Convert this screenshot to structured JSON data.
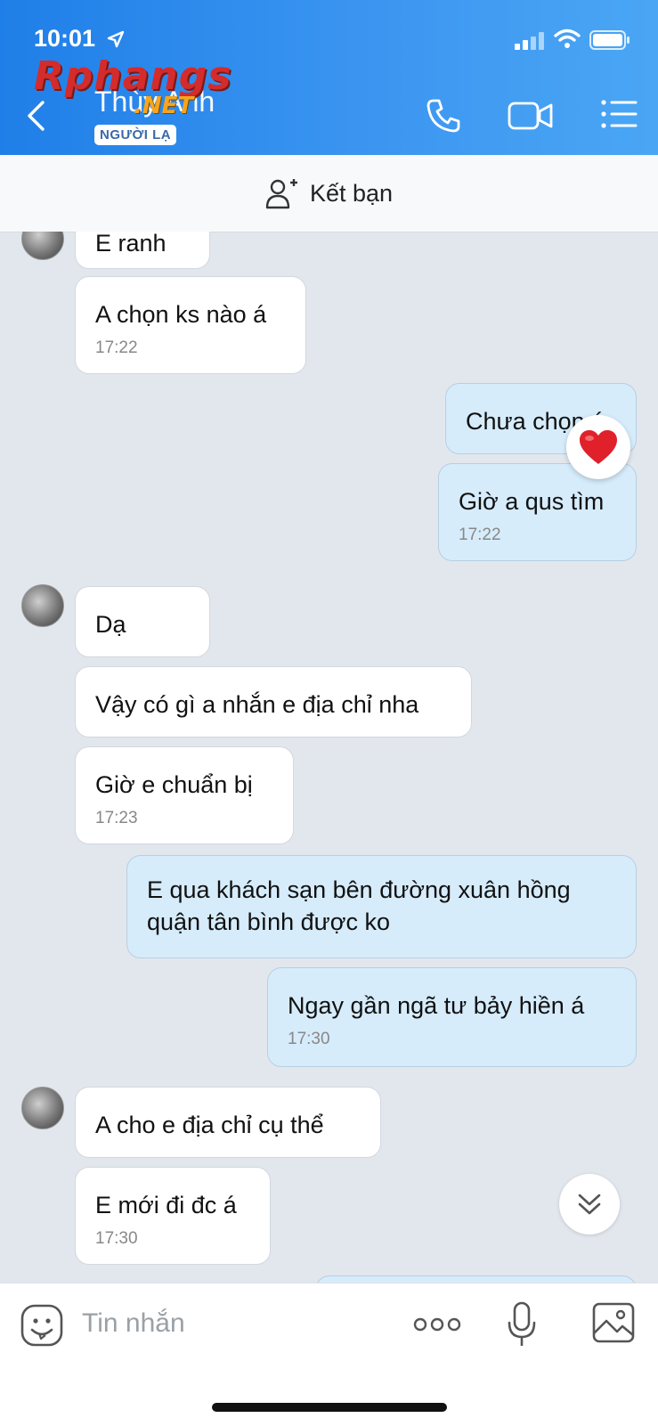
{
  "status_bar": {
    "time": "10:01"
  },
  "watermark": {
    "main": "Rphangs",
    "suffix": ".NET"
  },
  "header": {
    "contact_name": "Thùy Anh",
    "badge": "NGƯỜI LẠ"
  },
  "add_friend": {
    "label": "Kết bạn"
  },
  "messages": [
    {
      "text": "E ranh",
      "time": ""
    },
    {
      "text": "A chọn ks nào á",
      "time": "17:22"
    },
    {
      "text": "Chưa chọn á",
      "time": ""
    },
    {
      "text": "Giờ a qus tìm",
      "time": "17:22"
    },
    {
      "text": "Dạ",
      "time": ""
    },
    {
      "text": "Vậy có gì a nhắn e địa chỉ nha",
      "time": ""
    },
    {
      "text": "Giờ e chuẩn bị",
      "time": "17:23"
    },
    {
      "text": "E qua khách sạn bên đường xuân hồng quận tân bình được ko",
      "time": ""
    },
    {
      "text": "Ngay gần ngã tư bảy hiền á",
      "time": "17:30"
    },
    {
      "text": "A cho e địa chỉ cụ thể",
      "time": ""
    },
    {
      "text": "E mới đi đc á",
      "time": "17:30"
    }
  ],
  "reaction": {
    "icon": "heart-icon",
    "color": "#e0202b"
  },
  "input": {
    "placeholder": "Tin nhắn"
  },
  "colors": {
    "header": "#2a8aee",
    "outgoing_bubble": "#d6ecfb",
    "incoming_bubble": "#ffffff",
    "chat_bg": "#e2e7ee"
  }
}
